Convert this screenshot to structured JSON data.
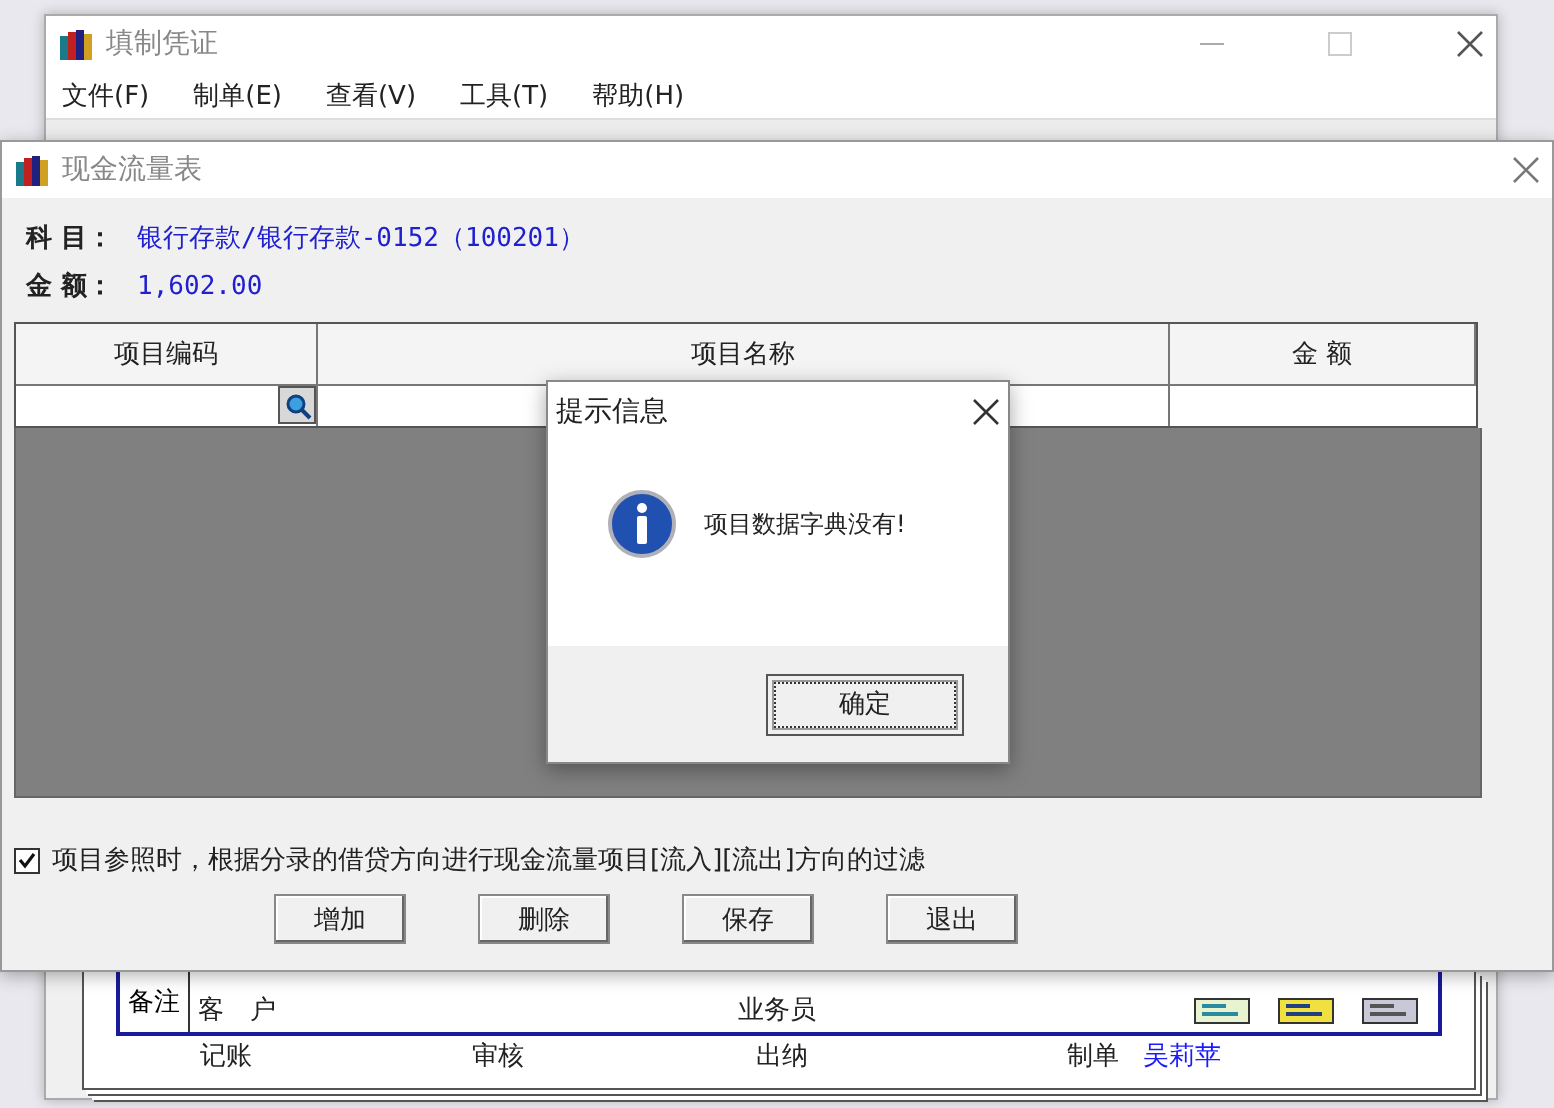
{
  "main_window": {
    "title": "填制凭证",
    "menu": [
      "文件(F)",
      "制单(E)",
      "查看(V)",
      "工具(T)",
      "帮助(H)"
    ],
    "voucher": {
      "remark_label": "备注",
      "fields": [
        {
          "label": "客　户"
        },
        {
          "label": "业务员"
        }
      ],
      "signatures": [
        {
          "label": "记账"
        },
        {
          "label": "审核"
        },
        {
          "label": "出纳"
        },
        {
          "label": "制单",
          "value": "吴莉苹"
        }
      ]
    }
  },
  "cash_flow_dialog": {
    "title": "现金流量表",
    "account_label": "科 目：",
    "account": "银行存款/银行存款-0152（100201）",
    "amount_label": "金 额：",
    "amount": "1,602.00",
    "table": {
      "columns": [
        "项目编码",
        "项目名称",
        "金 额"
      ]
    },
    "filter_option": {
      "label": "项目参照时，根据分录的借贷方向进行现金流量项目[流入][流出]方向的过滤",
      "checked": true
    },
    "buttons": [
      "增加",
      "删除",
      "保存",
      "退出"
    ]
  },
  "message_box": {
    "title": "提示信息",
    "message": "项目数据字典没有!",
    "button": "确定"
  }
}
